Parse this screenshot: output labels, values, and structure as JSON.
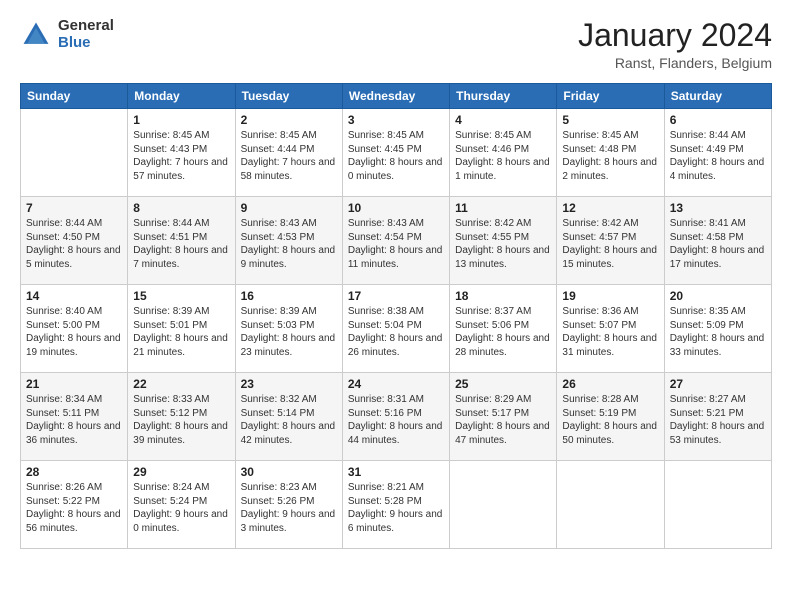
{
  "header": {
    "logo_general": "General",
    "logo_blue": "Blue",
    "month_title": "January 2024",
    "location": "Ranst, Flanders, Belgium"
  },
  "days_of_week": [
    "Sunday",
    "Monday",
    "Tuesday",
    "Wednesday",
    "Thursday",
    "Friday",
    "Saturday"
  ],
  "weeks": [
    [
      {
        "day": "",
        "sunrise": "",
        "sunset": "",
        "daylight": ""
      },
      {
        "day": "1",
        "sunrise": "Sunrise: 8:45 AM",
        "sunset": "Sunset: 4:43 PM",
        "daylight": "Daylight: 7 hours and 57 minutes."
      },
      {
        "day": "2",
        "sunrise": "Sunrise: 8:45 AM",
        "sunset": "Sunset: 4:44 PM",
        "daylight": "Daylight: 7 hours and 58 minutes."
      },
      {
        "day": "3",
        "sunrise": "Sunrise: 8:45 AM",
        "sunset": "Sunset: 4:45 PM",
        "daylight": "Daylight: 8 hours and 0 minutes."
      },
      {
        "day": "4",
        "sunrise": "Sunrise: 8:45 AM",
        "sunset": "Sunset: 4:46 PM",
        "daylight": "Daylight: 8 hours and 1 minute."
      },
      {
        "day": "5",
        "sunrise": "Sunrise: 8:45 AM",
        "sunset": "Sunset: 4:48 PM",
        "daylight": "Daylight: 8 hours and 2 minutes."
      },
      {
        "day": "6",
        "sunrise": "Sunrise: 8:44 AM",
        "sunset": "Sunset: 4:49 PM",
        "daylight": "Daylight: 8 hours and 4 minutes."
      }
    ],
    [
      {
        "day": "7",
        "sunrise": "Sunrise: 8:44 AM",
        "sunset": "Sunset: 4:50 PM",
        "daylight": "Daylight: 8 hours and 5 minutes."
      },
      {
        "day": "8",
        "sunrise": "Sunrise: 8:44 AM",
        "sunset": "Sunset: 4:51 PM",
        "daylight": "Daylight: 8 hours and 7 minutes."
      },
      {
        "day": "9",
        "sunrise": "Sunrise: 8:43 AM",
        "sunset": "Sunset: 4:53 PM",
        "daylight": "Daylight: 8 hours and 9 minutes."
      },
      {
        "day": "10",
        "sunrise": "Sunrise: 8:43 AM",
        "sunset": "Sunset: 4:54 PM",
        "daylight": "Daylight: 8 hours and 11 minutes."
      },
      {
        "day": "11",
        "sunrise": "Sunrise: 8:42 AM",
        "sunset": "Sunset: 4:55 PM",
        "daylight": "Daylight: 8 hours and 13 minutes."
      },
      {
        "day": "12",
        "sunrise": "Sunrise: 8:42 AM",
        "sunset": "Sunset: 4:57 PM",
        "daylight": "Daylight: 8 hours and 15 minutes."
      },
      {
        "day": "13",
        "sunrise": "Sunrise: 8:41 AM",
        "sunset": "Sunset: 4:58 PM",
        "daylight": "Daylight: 8 hours and 17 minutes."
      }
    ],
    [
      {
        "day": "14",
        "sunrise": "Sunrise: 8:40 AM",
        "sunset": "Sunset: 5:00 PM",
        "daylight": "Daylight: 8 hours and 19 minutes."
      },
      {
        "day": "15",
        "sunrise": "Sunrise: 8:39 AM",
        "sunset": "Sunset: 5:01 PM",
        "daylight": "Daylight: 8 hours and 21 minutes."
      },
      {
        "day": "16",
        "sunrise": "Sunrise: 8:39 AM",
        "sunset": "Sunset: 5:03 PM",
        "daylight": "Daylight: 8 hours and 23 minutes."
      },
      {
        "day": "17",
        "sunrise": "Sunrise: 8:38 AM",
        "sunset": "Sunset: 5:04 PM",
        "daylight": "Daylight: 8 hours and 26 minutes."
      },
      {
        "day": "18",
        "sunrise": "Sunrise: 8:37 AM",
        "sunset": "Sunset: 5:06 PM",
        "daylight": "Daylight: 8 hours and 28 minutes."
      },
      {
        "day": "19",
        "sunrise": "Sunrise: 8:36 AM",
        "sunset": "Sunset: 5:07 PM",
        "daylight": "Daylight: 8 hours and 31 minutes."
      },
      {
        "day": "20",
        "sunrise": "Sunrise: 8:35 AM",
        "sunset": "Sunset: 5:09 PM",
        "daylight": "Daylight: 8 hours and 33 minutes."
      }
    ],
    [
      {
        "day": "21",
        "sunrise": "Sunrise: 8:34 AM",
        "sunset": "Sunset: 5:11 PM",
        "daylight": "Daylight: 8 hours and 36 minutes."
      },
      {
        "day": "22",
        "sunrise": "Sunrise: 8:33 AM",
        "sunset": "Sunset: 5:12 PM",
        "daylight": "Daylight: 8 hours and 39 minutes."
      },
      {
        "day": "23",
        "sunrise": "Sunrise: 8:32 AM",
        "sunset": "Sunset: 5:14 PM",
        "daylight": "Daylight: 8 hours and 42 minutes."
      },
      {
        "day": "24",
        "sunrise": "Sunrise: 8:31 AM",
        "sunset": "Sunset: 5:16 PM",
        "daylight": "Daylight: 8 hours and 44 minutes."
      },
      {
        "day": "25",
        "sunrise": "Sunrise: 8:29 AM",
        "sunset": "Sunset: 5:17 PM",
        "daylight": "Daylight: 8 hours and 47 minutes."
      },
      {
        "day": "26",
        "sunrise": "Sunrise: 8:28 AM",
        "sunset": "Sunset: 5:19 PM",
        "daylight": "Daylight: 8 hours and 50 minutes."
      },
      {
        "day": "27",
        "sunrise": "Sunrise: 8:27 AM",
        "sunset": "Sunset: 5:21 PM",
        "daylight": "Daylight: 8 hours and 53 minutes."
      }
    ],
    [
      {
        "day": "28",
        "sunrise": "Sunrise: 8:26 AM",
        "sunset": "Sunset: 5:22 PM",
        "daylight": "Daylight: 8 hours and 56 minutes."
      },
      {
        "day": "29",
        "sunrise": "Sunrise: 8:24 AM",
        "sunset": "Sunset: 5:24 PM",
        "daylight": "Daylight: 9 hours and 0 minutes."
      },
      {
        "day": "30",
        "sunrise": "Sunrise: 8:23 AM",
        "sunset": "Sunset: 5:26 PM",
        "daylight": "Daylight: 9 hours and 3 minutes."
      },
      {
        "day": "31",
        "sunrise": "Sunrise: 8:21 AM",
        "sunset": "Sunset: 5:28 PM",
        "daylight": "Daylight: 9 hours and 6 minutes."
      },
      {
        "day": "",
        "sunrise": "",
        "sunset": "",
        "daylight": ""
      },
      {
        "day": "",
        "sunrise": "",
        "sunset": "",
        "daylight": ""
      },
      {
        "day": "",
        "sunrise": "",
        "sunset": "",
        "daylight": ""
      }
    ]
  ]
}
